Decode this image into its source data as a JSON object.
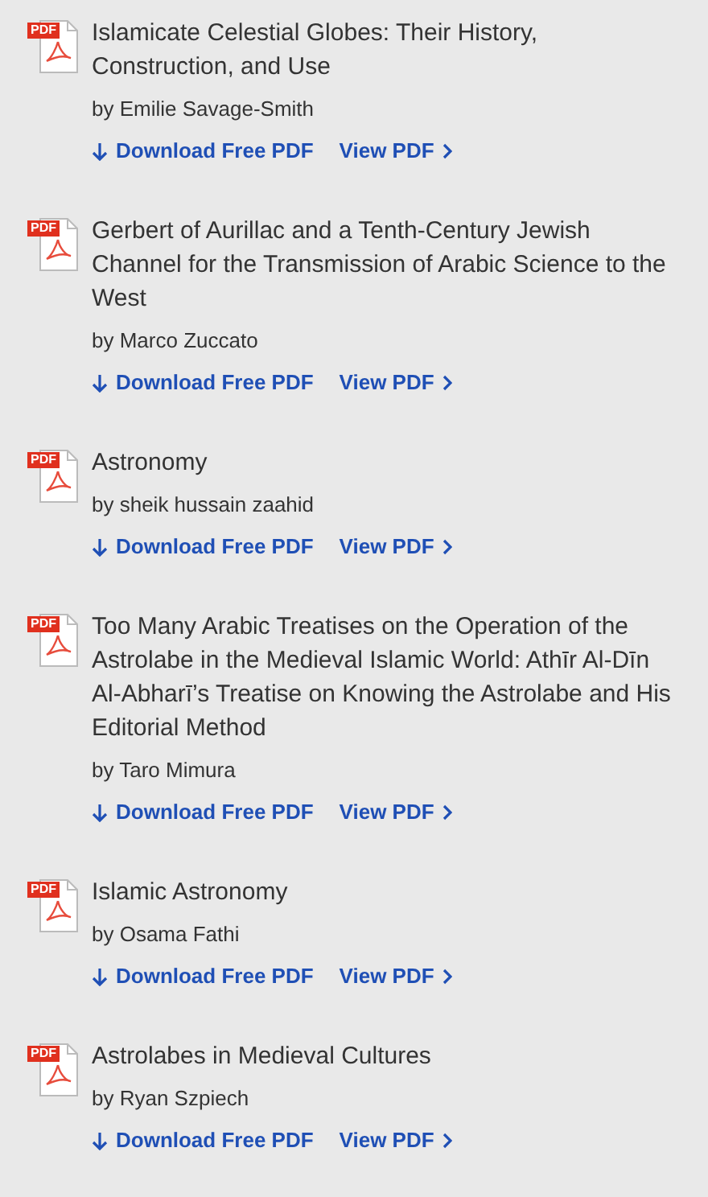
{
  "papers": [
    {
      "icon_label": "PDF",
      "title": "Islamicate Celestial Globes: Their History, Construction, and Use",
      "author": "by Emilie Savage-Smith",
      "download": "Download Free PDF",
      "view": "View PDF"
    },
    {
      "icon_label": "PDF",
      "title": "Gerbert of Aurillac and a Tenth-Century Jewish Channel for the Transmission of Arabic Science to the West",
      "author": "by Marco Zuccato",
      "download": "Download Free PDF",
      "view": "View PDF"
    },
    {
      "icon_label": "PDF",
      "title": "Astronomy",
      "author": "by sheik hussain zaahid",
      "download": "Download Free PDF",
      "view": "View PDF"
    },
    {
      "icon_label": "PDF",
      "title": "Too Many Arabic Treatises on the Operation of the Astrolabe in the Medieval Islamic World: Athīr Al-Dīn Al-Abharī’s Treatise on Knowing the Astrolabe and His Editorial Method",
      "author": "by Taro Mimura",
      "download": "Download Free PDF",
      "view": "View PDF"
    },
    {
      "icon_label": "PDF",
      "title": "Islamic Astronomy",
      "author": "by Osama Fathi",
      "download": "Download Free PDF",
      "view": "View PDF"
    },
    {
      "icon_label": "PDF",
      "title": "Astrolabes in Medieval Cultures",
      "author": "by Ryan Szpiech",
      "download": "Download Free PDF",
      "view": "View PDF"
    }
  ]
}
